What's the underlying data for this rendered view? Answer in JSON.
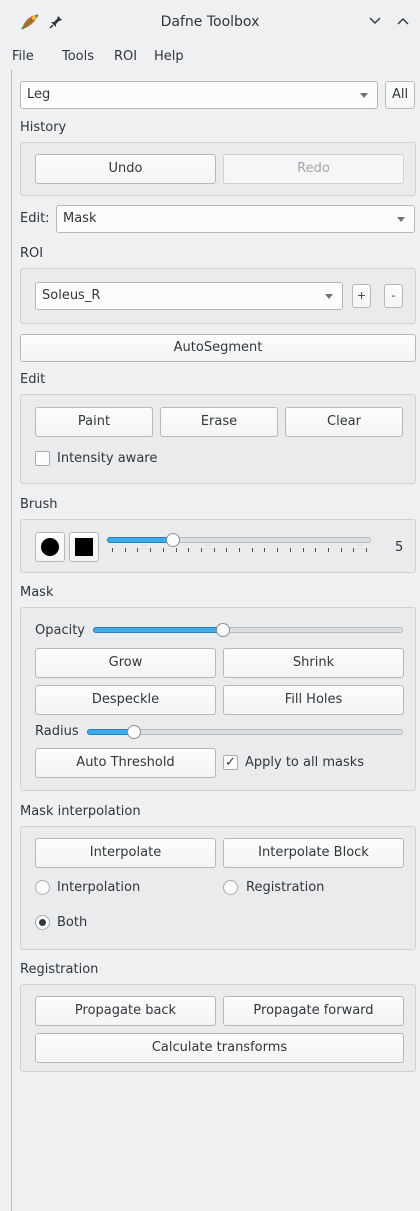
{
  "window": {
    "title": "Dafne Toolbox",
    "icons": [
      "app-logo-icon",
      "pin-icon",
      "minimize-chevron-icon",
      "maximize-chevron-icon"
    ]
  },
  "menu": [
    "File",
    "Tools",
    "ROI",
    "Help"
  ],
  "dataset": {
    "value": "Leg",
    "all_label": "All"
  },
  "history": {
    "title": "History",
    "undo": "Undo",
    "redo": "Redo"
  },
  "edit_mode": {
    "label": "Edit:",
    "value": "Mask"
  },
  "roi": {
    "title": "ROI",
    "value": "Soleus_R",
    "add": "+",
    "remove": "-"
  },
  "autosegment": "AutoSegment",
  "edit": {
    "title": "Edit",
    "paint": "Paint",
    "erase": "Erase",
    "clear": "Clear",
    "intensity_aware": "Intensity aware",
    "intensity_checked": false
  },
  "brush": {
    "title": "Brush",
    "size_value": "5",
    "size": 5,
    "size_min": 0,
    "size_max": 20
  },
  "mask": {
    "title": "Mask",
    "opacity_label": "Opacity",
    "opacity": 0.42,
    "grow": "Grow",
    "shrink": "Shrink",
    "despeckle": "Despeckle",
    "fill_holes": "Fill Holes",
    "radius_label": "Radius",
    "radius": 0.15,
    "auto_threshold": "Auto Threshold",
    "apply_all": "Apply to all masks",
    "apply_all_checked": true
  },
  "interp": {
    "title": "Mask interpolation",
    "interpolate": "Interpolate",
    "interpolate_block": "Interpolate Block",
    "opt_interpolation": "Interpolation",
    "opt_registration": "Registration",
    "opt_both": "Both",
    "selected": "Both"
  },
  "registration": {
    "title": "Registration",
    "back": "Propagate back",
    "forward": "Propagate forward",
    "calc": "Calculate transforms"
  },
  "colors": {
    "accent": "#3daee9",
    "background": "#eff0f1"
  }
}
